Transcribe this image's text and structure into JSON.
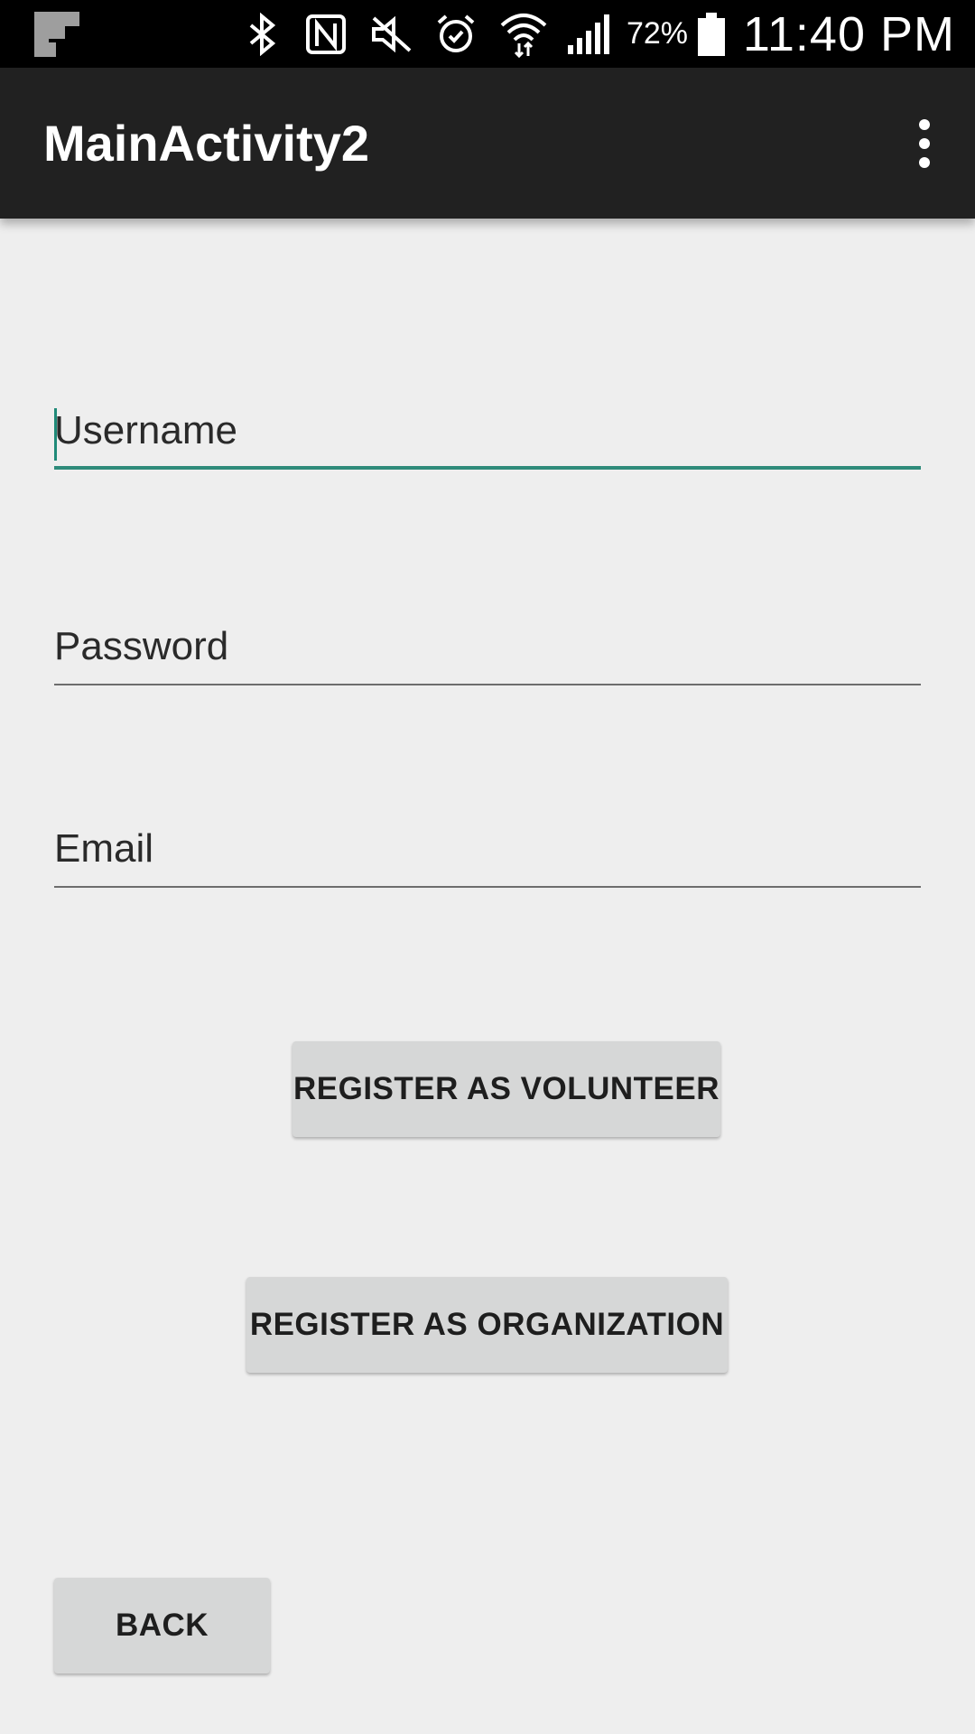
{
  "status_bar": {
    "notification_icon": "app-notification-icon",
    "icons": [
      "bluetooth-icon",
      "nfc-icon",
      "mute-icon",
      "alarm-icon",
      "wifi-icon",
      "signal-icon",
      "battery-icon"
    ],
    "battery_percent": "72%",
    "time": "11:40 PM"
  },
  "app_bar": {
    "title": "MainActivity2",
    "overflow_icon": "more-vert-icon"
  },
  "form": {
    "username_placeholder": "Username",
    "password_placeholder": "Password",
    "email_placeholder": "Email"
  },
  "buttons": {
    "register_volunteer": "REGISTER AS VOLUNTEER",
    "register_organization": "REGISTER AS ORGANIZATION",
    "back": "BACK"
  },
  "colors": {
    "accent": "#2e8b7a",
    "app_bar": "#212121",
    "background": "#eeeeee",
    "button": "#d6d7d7"
  }
}
